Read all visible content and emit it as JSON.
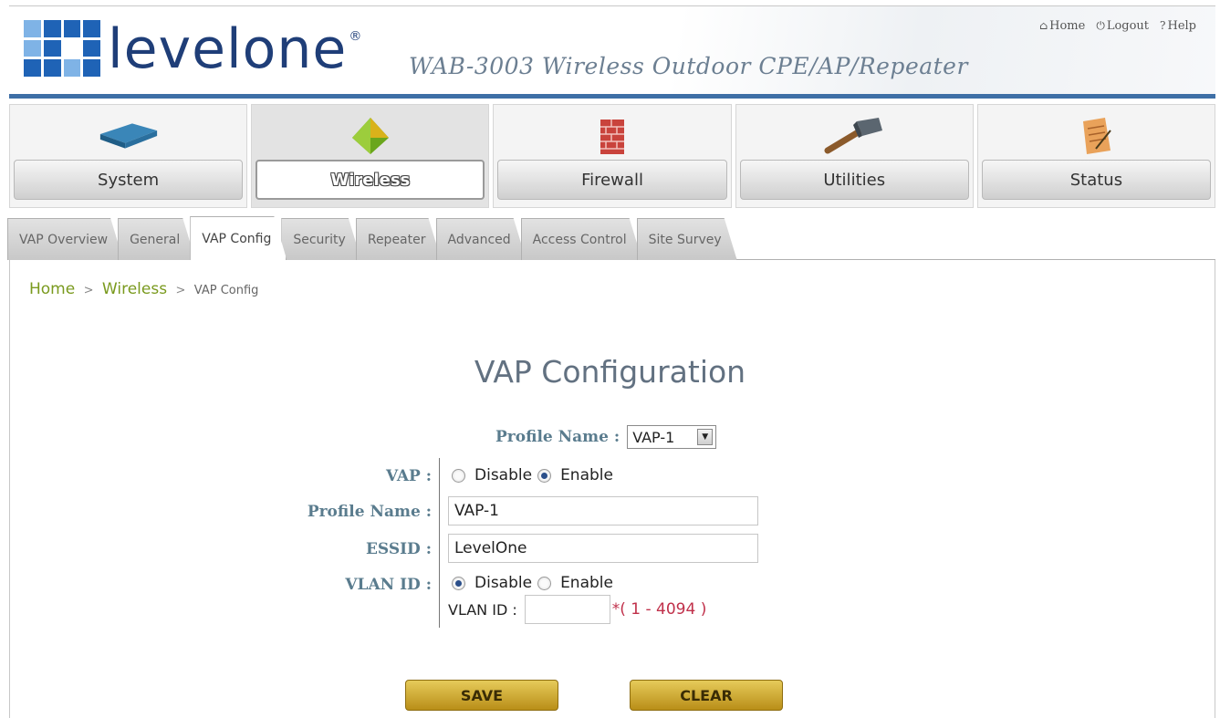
{
  "header": {
    "brand": "levelone",
    "product": "WAB-3003 Wireless Outdoor CPE/AP/Repeater",
    "links": [
      {
        "label": "Home",
        "icon": "home-icon"
      },
      {
        "label": "Logout",
        "icon": "logout-icon"
      },
      {
        "label": "Help",
        "icon": "help-icon"
      }
    ]
  },
  "nav": [
    {
      "label": "System",
      "icon": "router-icon"
    },
    {
      "label": "Wireless",
      "icon": "antenna-icon",
      "active": true
    },
    {
      "label": "Firewall",
      "icon": "firewall-icon"
    },
    {
      "label": "Utilities",
      "icon": "hammer-icon"
    },
    {
      "label": "Status",
      "icon": "clipboard-icon"
    }
  ],
  "tabs": [
    {
      "label": "VAP Overview"
    },
    {
      "label": "General"
    },
    {
      "label": "VAP Config",
      "active": true
    },
    {
      "label": "Security"
    },
    {
      "label": "Repeater"
    },
    {
      "label": "Advanced"
    },
    {
      "label": "Access Control"
    },
    {
      "label": "Site Survey"
    }
  ],
  "breadcrumb": {
    "home": "Home",
    "sep": ">",
    "section": "Wireless",
    "current": "VAP Config"
  },
  "page": {
    "title": "VAP Configuration"
  },
  "profile_select": {
    "label": "Profile Name :",
    "value": "VAP-1"
  },
  "form": {
    "vap": {
      "label": "VAP :",
      "options": [
        "Disable",
        "Enable"
      ],
      "selected": "Enable"
    },
    "profile_name": {
      "label": "Profile Name :",
      "value": "VAP-1"
    },
    "essid": {
      "label": "ESSID :",
      "value": "LevelOne"
    },
    "vlan": {
      "label": "VLAN ID :",
      "options": [
        "Disable",
        "Enable"
      ],
      "selected": "Disable",
      "sub_label": "VLAN ID :",
      "value": "",
      "hint": "*( 1 - 4094 )"
    }
  },
  "buttons": {
    "save": "SAVE",
    "clear": "CLEAR"
  },
  "colors": {
    "brand_blue": "#1f63b6",
    "header_rule": "#3e6fa6",
    "breadcrumb_green": "#7a9a1e",
    "label_blue": "#5a7c8e",
    "button_gold": "#c9a22a",
    "required_red": "#c0304a"
  }
}
